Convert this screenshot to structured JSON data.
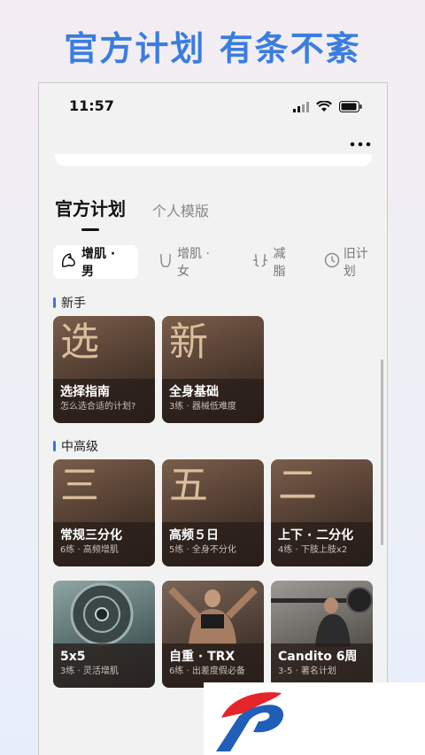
{
  "headline": "官方计划 有条不紊",
  "status": {
    "time": "11:57"
  },
  "tabs": [
    {
      "label": "官方计划",
      "active": true
    },
    {
      "label": "个人模版",
      "active": false
    }
  ],
  "filters": [
    {
      "label": "增肌 · 男",
      "icon": "muscle-arm-icon",
      "active": true
    },
    {
      "label": "增肌 · 女",
      "icon": "torso-icon",
      "active": false
    },
    {
      "label": "减脂",
      "icon": "waist-icon",
      "active": false
    },
    {
      "label": "旧计划",
      "icon": "clock-icon",
      "active": false
    }
  ],
  "sections": [
    {
      "title": "新手",
      "cards": [
        {
          "char": "选",
          "title": "选择指南",
          "sub": "怎么选合适的计划?"
        },
        {
          "char": "新",
          "title": "全身基础",
          "sub": "3练 · 器械低难度"
        }
      ]
    },
    {
      "title": "中高级",
      "rows": [
        [
          {
            "char": "三",
            "title": "常规三分化",
            "sub": "6练 · 高频增肌"
          },
          {
            "char": "五",
            "title": "高频５日",
            "sub": "5练 · 全身不分化"
          },
          {
            "char": "二",
            "title": "上下 · 二分化",
            "sub": "4练 · 下肢上肢x2"
          }
        ],
        [
          {
            "char": "",
            "title": "5x5",
            "sub": "3练 · 灵活增肌",
            "style": "plate"
          },
          {
            "char": "",
            "title": "自重 · TRX",
            "sub": "6练 · 出差度假必备",
            "style": "trx"
          },
          {
            "char": "",
            "title": "Candito 6周",
            "sub": "3-5 · 著名计划",
            "style": "gym"
          }
        ]
      ]
    }
  ],
  "colors": {
    "accent": "#3a7de0",
    "section_bar": "#2d7be5",
    "logo_red": "#e5252a",
    "logo_blue": "#1f5fb8"
  }
}
